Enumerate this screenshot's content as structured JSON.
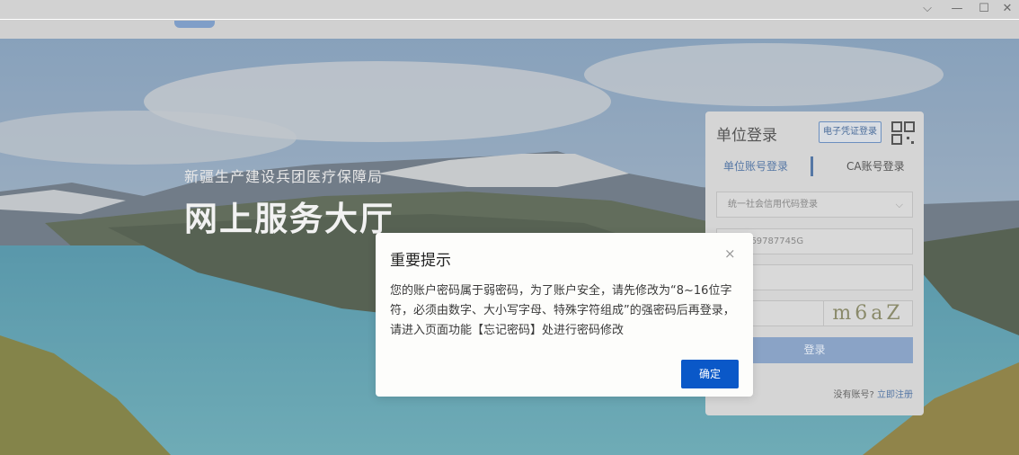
{
  "window": {
    "controls": {
      "dropdown": "⌵",
      "minimize": "—",
      "maximize": "☐",
      "close": "✕"
    }
  },
  "hero": {
    "subtitle": "新疆生产建设兵团医疗保障局",
    "title": "网上服务大厅"
  },
  "login": {
    "title": "单位登录",
    "cert_login": "电子凭证登录",
    "tabs": {
      "unit_account": "单位账号登录",
      "ca_account": "CA账号登录"
    },
    "login_type_select": "统一社会信用代码登录",
    "account_value": "100069787745G",
    "password_mask": "········",
    "captcha_text": "m6aZ",
    "submit": "登录",
    "no_account": "没有账号?",
    "register": "立即注册"
  },
  "modal": {
    "title": "重要提示",
    "close": "×",
    "message": "您的账户密码属于弱密码，为了账户安全，请先修改为“8~16位字符，必须由数字、大小写字母、特殊字符组成”的强密码后再登录，请进入页面功能【忘记密码】处进行密码修改",
    "confirm": "确定"
  },
  "colors": {
    "primary_button": "#0a58c8",
    "accent_link": "#5577a5",
    "modal_bg": "#fdfdfb"
  }
}
